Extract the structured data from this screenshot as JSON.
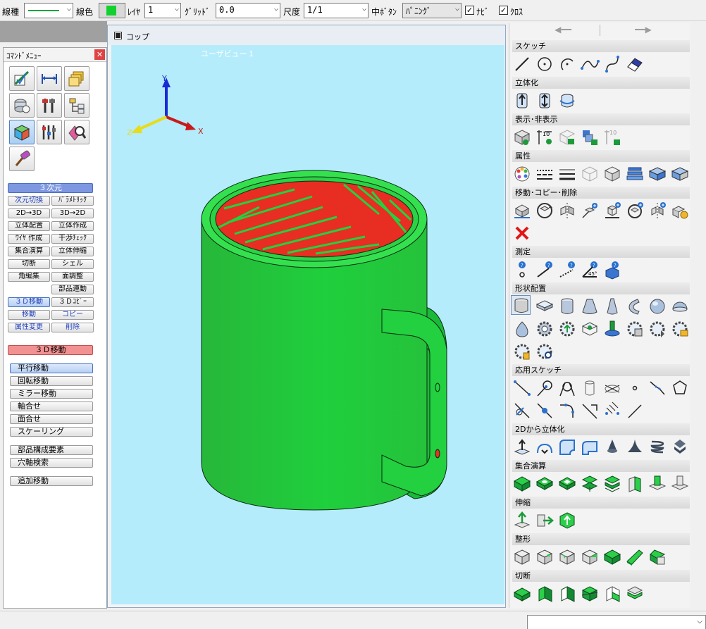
{
  "toolbar": {
    "linetype_label": "線種",
    "linecolor_label": "線色",
    "layer_label": "ﾚｲﾔ",
    "layer_value": "1",
    "grid_label": "ｸﾞﾘｯﾄﾞ",
    "grid_value": "0.0",
    "scale_label": "尺度",
    "scale_value": "1/1",
    "middle_button_label": "中ﾎﾞﾀﾝ",
    "middle_button_value": "ﾊﾟﾆﾝｸﾞ",
    "nabi_label": "ﾅﾋﾞ",
    "cross_label": "ｸﾛｽ",
    "linetype_color": "#1aa33d",
    "linecolor_swatch": "#12d12e"
  },
  "left_panel": {
    "title": "ｺﾏﾝﾄﾞﾒﾆｭｰ",
    "section_3d": "３次元",
    "commands": [
      "次元切換",
      "ﾊﾟﾗﾒﾄﾘｯｸ",
      "2D→3D",
      "3D→2D",
      "立体配置",
      "立体作成",
      "ﾜｲﾔ 作成",
      "干渉ﾁｪｯｸ",
      "集合演算",
      "立体伸縮",
      "切断",
      "シェル",
      "角編集",
      "面調整",
      "部品連動",
      "３Ｄ移動",
      "３Ｄｺﾋﾟｰ",
      "移動",
      "コピー",
      "属性変更",
      "削除"
    ],
    "section_move": "３Ｄ移動",
    "move_commands": [
      "平行移動",
      "回転移動",
      "ミラー移動",
      "軸合せ",
      "面合せ",
      "スケーリング",
      "部品構成要素",
      "穴軸検索",
      "追加移動"
    ]
  },
  "viewport": {
    "window_title": "コップ",
    "view_name": "ユーザビュー１",
    "axis_x": "X",
    "axis_y": "Y",
    "axis_z": "Z",
    "mug_color": "#1ec73b",
    "mug_interior_color": "#e82e22"
  },
  "right_panel": {
    "sections": [
      "スケッチ",
      "立体化",
      "表示･非表示",
      "属性",
      "移動･コピー･削除",
      "測定",
      "形状配置",
      "応用スケッチ",
      "2Dから立体化",
      "集合演算",
      "伸縮",
      "整形",
      "切断"
    ]
  }
}
